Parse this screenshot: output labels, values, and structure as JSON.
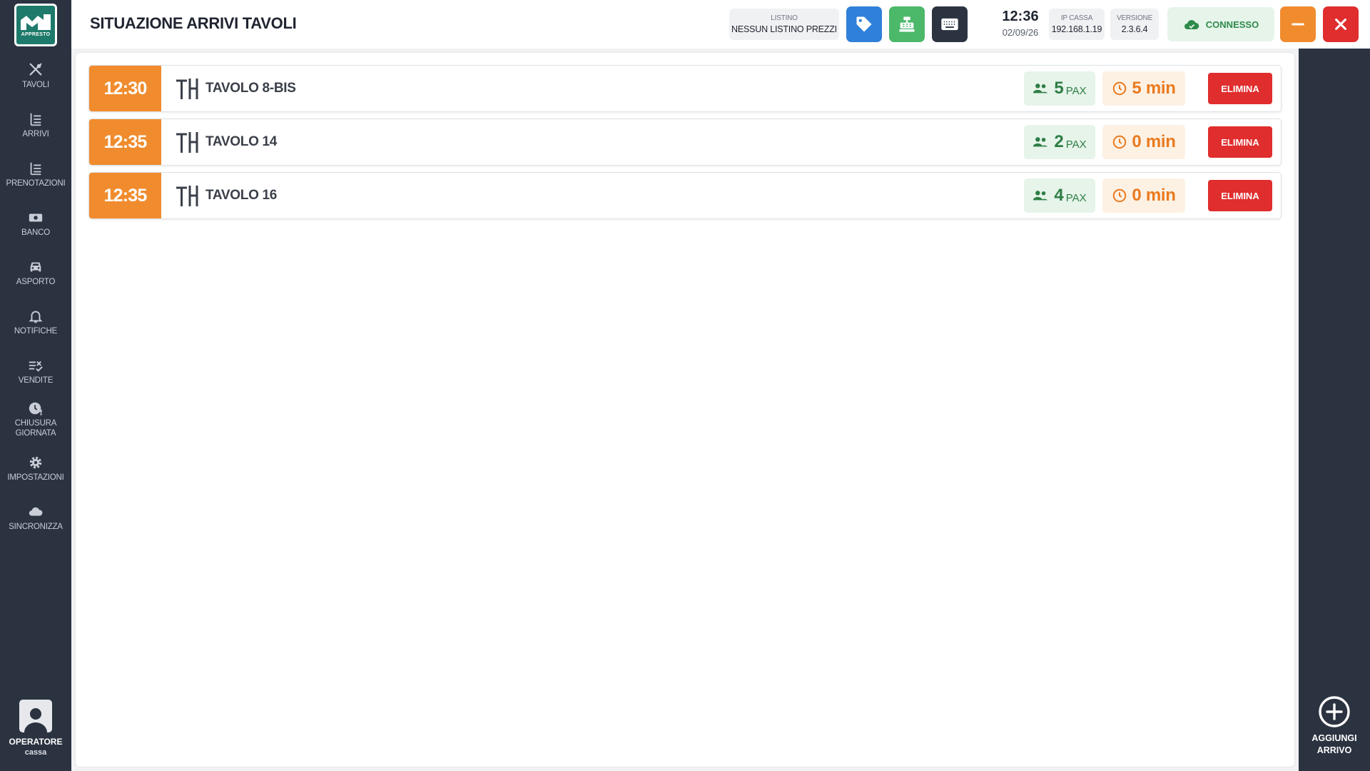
{
  "app": {
    "logo_text": "APPRESTO",
    "page_title": "SITUAZIONE ARRIVI TAVOLI"
  },
  "sidebar": {
    "items": [
      {
        "label": "TAVOLI",
        "icon": "cutlery-icon"
      },
      {
        "label": "ARRIVI",
        "icon": "list-icon"
      },
      {
        "label": "PRENOTAZIONI",
        "icon": "list-icon"
      },
      {
        "label": "BANCO",
        "icon": "cash-icon"
      },
      {
        "label": "ASPORTO",
        "icon": "car-icon"
      },
      {
        "label": "NOTIFICHE",
        "icon": "bell-icon"
      },
      {
        "label": "VENDITE",
        "icon": "list-check-icon"
      },
      {
        "label_line1": "CHIUSURA",
        "label_line2": "GIORNATA",
        "icon": "clock-alert-icon"
      },
      {
        "label": "IMPOSTAZIONI",
        "icon": "gear-icon"
      },
      {
        "label": "SINCRONIZZA",
        "icon": "cloud-icon"
      }
    ],
    "operator": {
      "label": "OPERATORE",
      "name": "cassa"
    }
  },
  "topbar": {
    "listino_label": "LISTINO",
    "listino_value": "NESSUN LISTINO PREZZI",
    "time": "12:36",
    "date": "02/09/26",
    "ip_label": "IP CASSA",
    "ip_value": "192.168.1.19",
    "version_label": "VERSIONE",
    "version_value": "2.3.6.4",
    "status": "CONNESSO"
  },
  "arrivals": [
    {
      "time": "12:30",
      "table": "TAVOLO 8-BIS",
      "pax": "5",
      "pax_unit": "PAX",
      "wait": "5 min",
      "action": "ELIMINA"
    },
    {
      "time": "12:35",
      "table": "TAVOLO 14",
      "pax": "2",
      "pax_unit": "PAX",
      "wait": "0 min",
      "action": "ELIMINA"
    },
    {
      "time": "12:35",
      "table": "TAVOLO 16",
      "pax": "4",
      "pax_unit": "PAX",
      "wait": "0 min",
      "action": "ELIMINA"
    }
  ],
  "add_arrival": {
    "line1": "AGGIUNGI",
    "line2": "ARRIVO"
  },
  "colors": {
    "sidebar_bg": "#2b3341",
    "accent_orange": "#f08c2e",
    "danger_red": "#e02d2d",
    "success_green": "#4cb86a",
    "primary_blue": "#2f80d8"
  }
}
